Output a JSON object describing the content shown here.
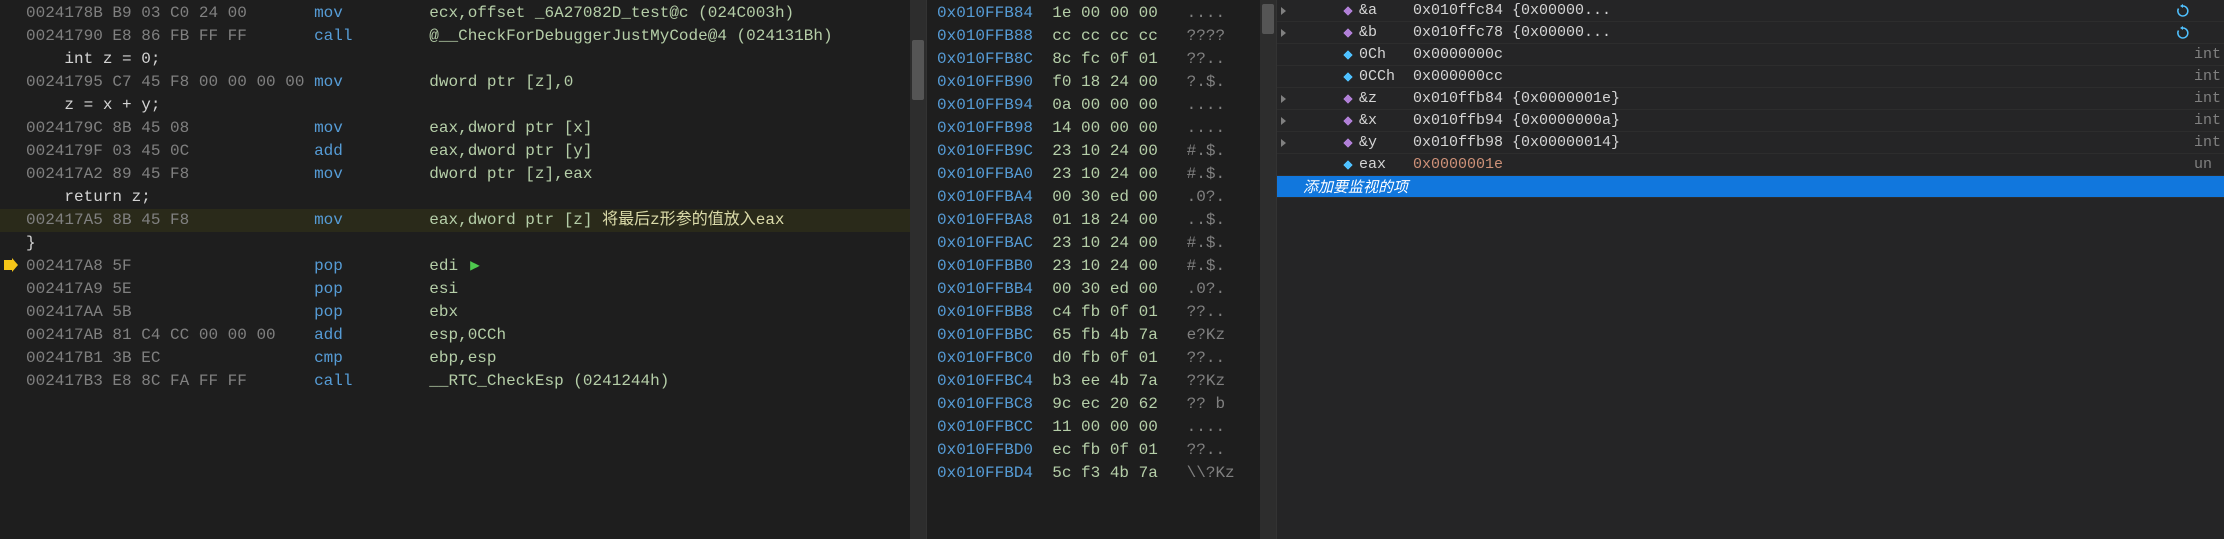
{
  "disassembly": {
    "current_line_index": 11,
    "lines": [
      {
        "addr": "0024178B",
        "bytes": "B9 03 C0 24 00",
        "mnem": "mov",
        "ops": "ecx,offset _6A27082D_test@c (024C003h)"
      },
      {
        "addr": "00241790",
        "bytes": "E8 86 FB FF FF",
        "mnem": "call",
        "ops": "@__CheckForDebuggerJustMyCode@4 (024131Bh)"
      },
      {
        "src": "    int z = 0;"
      },
      {
        "addr": "00241795",
        "bytes": "C7 45 F8 00 00 00 00",
        "mnem": "mov",
        "ops": "dword ptr [z],0"
      },
      {
        "src": "    z = x + y;"
      },
      {
        "addr": "0024179C",
        "bytes": "8B 45 08",
        "mnem": "mov",
        "ops": "eax,dword ptr [x]"
      },
      {
        "addr": "0024179F",
        "bytes": "03 45 0C",
        "mnem": "add",
        "ops": "eax,dword ptr [y]"
      },
      {
        "addr": "002417A2",
        "bytes": "89 45 F8",
        "mnem": "mov",
        "ops": "dword ptr [z],eax"
      },
      {
        "src": "    return z;"
      },
      {
        "addr": "002417A5",
        "bytes": "8B 45 F8",
        "mnem": "mov",
        "ops": "eax,dword ptr [z]",
        "cmt": "将最后z形参的值放入eax",
        "hi": true
      },
      {
        "src": "}"
      },
      {
        "addr": "002417A8",
        "bytes": "5F",
        "mnem": "pop",
        "ops": "edi",
        "runptr": true
      },
      {
        "addr": "002417A9",
        "bytes": "5E",
        "mnem": "pop",
        "ops": "esi"
      },
      {
        "addr": "002417AA",
        "bytes": "5B",
        "mnem": "pop",
        "ops": "ebx"
      },
      {
        "addr": "002417AB",
        "bytes": "81 C4 CC 00 00 00",
        "mnem": "add",
        "ops": "esp,0CCh"
      },
      {
        "addr": "002417B1",
        "bytes": "3B EC",
        "mnem": "cmp",
        "ops": "ebp,esp"
      },
      {
        "addr": "002417B3",
        "bytes": "E8 8C FA FF FF",
        "mnem": "call",
        "ops": "__RTC_CheckEsp (0241244h)"
      }
    ]
  },
  "memory": {
    "rows": [
      {
        "addr": "0x010FFB84",
        "hex": "1e 00 00 00",
        "ascii": "...."
      },
      {
        "addr": "0x010FFB88",
        "hex": "cc cc cc cc",
        "ascii": "????"
      },
      {
        "addr": "0x010FFB8C",
        "hex": "8c fc 0f 01",
        "ascii": "??.."
      },
      {
        "addr": "0x010FFB90",
        "hex": "f0 18 24 00",
        "ascii": "?.$."
      },
      {
        "addr": "0x010FFB94",
        "hex": "0a 00 00 00",
        "ascii": "...."
      },
      {
        "addr": "0x010FFB98",
        "hex": "14 00 00 00",
        "ascii": "...."
      },
      {
        "addr": "0x010FFB9C",
        "hex": "23 10 24 00",
        "ascii": "#.$."
      },
      {
        "addr": "0x010FFBA0",
        "hex": "23 10 24 00",
        "ascii": "#.$."
      },
      {
        "addr": "0x010FFBA4",
        "hex": "00 30 ed 00",
        "ascii": ".0?."
      },
      {
        "addr": "0x010FFBA8",
        "hex": "01 18 24 00",
        "ascii": "..$."
      },
      {
        "addr": "0x010FFBAC",
        "hex": "23 10 24 00",
        "ascii": "#.$."
      },
      {
        "addr": "0x010FFBB0",
        "hex": "23 10 24 00",
        "ascii": "#.$."
      },
      {
        "addr": "0x010FFBB4",
        "hex": "00 30 ed 00",
        "ascii": ".0?."
      },
      {
        "addr": "0x010FFBB8",
        "hex": "c4 fb 0f 01",
        "ascii": "??.."
      },
      {
        "addr": "0x010FFBBC",
        "hex": "65 fb 4b 7a",
        "ascii": "e?Kz"
      },
      {
        "addr": "0x010FFBC0",
        "hex": "d0 fb 0f 01",
        "ascii": "??.."
      },
      {
        "addr": "0x010FFBC4",
        "hex": "b3 ee 4b 7a",
        "ascii": "??Kz"
      },
      {
        "addr": "0x010FFBC8",
        "hex": "9c ec 20 62",
        "ascii": "?? b"
      },
      {
        "addr": "0x010FFBCC",
        "hex": "11 00 00 00",
        "ascii": "...."
      },
      {
        "addr": "0x010FFBD0",
        "hex": "ec fb 0f 01",
        "ascii": "??.."
      },
      {
        "addr": "0x010FFBD4",
        "hex": "5c f3 4b 7a",
        "ascii": "\\\\?Kz"
      }
    ]
  },
  "watch": {
    "add_placeholder": "添加要监视的项",
    "rows": [
      {
        "depth": 0,
        "expand": "closed",
        "icon": "diamond-purple",
        "name": "&a",
        "value": "0x010ffc84 {0x00000...",
        "type": "",
        "refresh": true
      },
      {
        "depth": 0,
        "expand": "closed",
        "icon": "diamond-purple",
        "name": "&b",
        "value": "0x010ffc78 {0x00000...",
        "type": "",
        "refresh": true
      },
      {
        "depth": 1,
        "expand": "none",
        "icon": "diamond-blue",
        "name": "0Ch",
        "value": "0x0000000c",
        "type": "int"
      },
      {
        "depth": 1,
        "expand": "none",
        "icon": "diamond-blue",
        "name": "0CCh",
        "value": "0x000000cc",
        "type": "int"
      },
      {
        "depth": 0,
        "expand": "closed",
        "icon": "diamond-purple",
        "name": "&z",
        "value": "0x010ffb84 {0x0000001e}",
        "type": "int"
      },
      {
        "depth": 0,
        "expand": "closed",
        "icon": "diamond-purple",
        "name": "&x",
        "value": "0x010ffb94 {0x0000000a}",
        "type": "int"
      },
      {
        "depth": 0,
        "expand": "closed",
        "icon": "diamond-purple",
        "name": "&y",
        "value": "0x010ffb98 {0x00000014}",
        "type": "int"
      },
      {
        "depth": 1,
        "expand": "none",
        "icon": "diamond-blue",
        "name": "eax",
        "value": "0x0000001e",
        "type": "un",
        "changed": true
      }
    ]
  }
}
